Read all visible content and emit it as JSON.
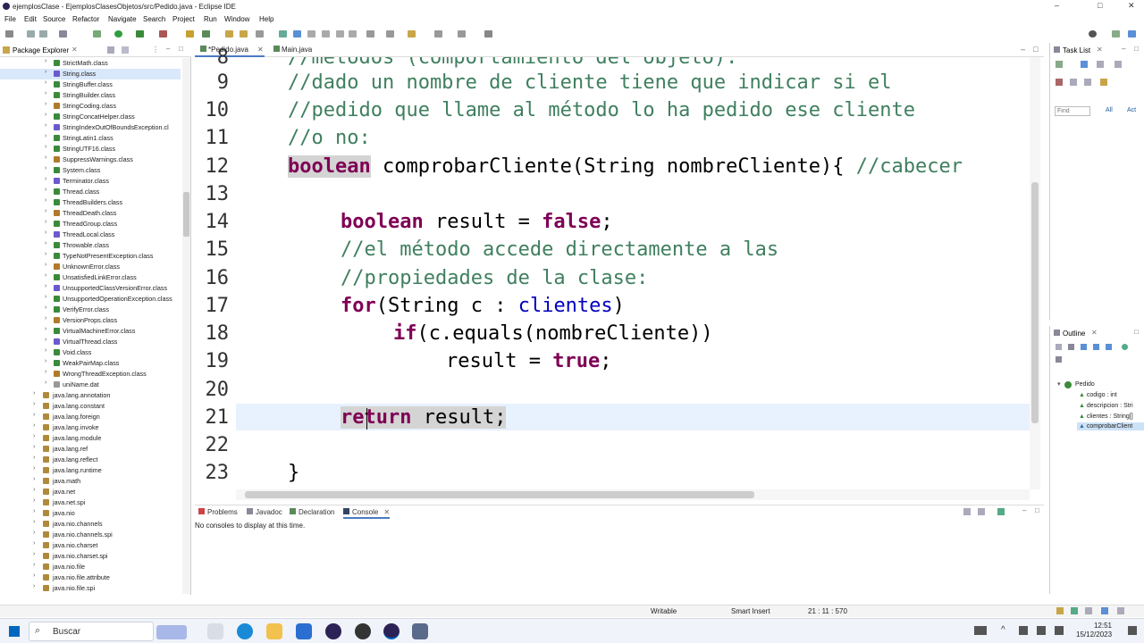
{
  "window": {
    "title": "ejemplosClase - EjemplosClasesObjetos/src/Pedido.java - Eclipse IDE",
    "min": "–",
    "max": "□",
    "close": "✕"
  },
  "menu": [
    "File",
    "Edit",
    "Source",
    "Refactor",
    "Navigate",
    "Search",
    "Project",
    "Run",
    "Window",
    "Help"
  ],
  "package_explorer": {
    "title": "Package Explorer",
    "classes": [
      "StrictMath.class",
      "String.class",
      "StringBuffer.class",
      "StringBuilder.class",
      "StringCoding.class",
      "StringConcatHelper.class",
      "StringIndexOutOfBoundsException.cl",
      "StringLatin1.class",
      "StringUTF16.class",
      "SuppressWarnings.class",
      "System.class",
      "Terminator.class",
      "Thread.class",
      "ThreadBuilders.class",
      "ThreadDeath.class",
      "ThreadGroup.class",
      "ThreadLocal.class",
      "Throwable.class",
      "TypeNotPresentException.class",
      "UnknownError.class",
      "UnsatisfiedLinkError.class",
      "UnsupportedClassVersionError.class",
      "UnsupportedOperationException.class",
      "VerifyError.class",
      "VersionProps.class",
      "VirtualMachineError.class",
      "VirtualThread.class",
      "Void.class",
      "WeakPairMap.class",
      "WrongThreadException.class",
      "uniName.dat"
    ],
    "packages": [
      "java.lang.annotation",
      "java.lang.constant",
      "java.lang.foreign",
      "java.lang.invoke",
      "java.lang.module",
      "java.lang.ref",
      "java.lang.reflect",
      "java.lang.runtime",
      "java.math",
      "java.net",
      "java.net.spi",
      "java.nio",
      "java.nio.channels",
      "java.nio.channels.spi",
      "java.nio.charset",
      "java.nio.charset.spi",
      "java.nio.file",
      "java.nio.file.attribute",
      "java.nio.file.spi"
    ]
  },
  "editor": {
    "tabs": [
      "*Pedido.java",
      "Main.java"
    ],
    "line_numbers": [
      "8",
      "9",
      "10",
      "11",
      "12",
      "13",
      "14",
      "15",
      "16",
      "17",
      "18",
      "19",
      "20",
      "21",
      "22",
      "23"
    ],
    "lines": {
      "l8": "//métodos (comportamiento del objeto):",
      "l9": "//dado un nombre de cliente tiene que indicar si el",
      "l10": "//pedido que llame al método lo ha pedido ese cliente",
      "l11": "//o no:",
      "l12_kw": "boolean",
      "l12_rest": " comprobarCliente(String nombreCliente){ ",
      "l12_cm": "//cabecer",
      "l14_kw": "boolean",
      "l14_mid": " result = ",
      "l14_kw2": "false",
      "l14_end": ";",
      "l15": "//el método accede directamente a las",
      "l16": "//propiedades de la clase:",
      "l17_kw": "for",
      "l17_mid": "(String c : ",
      "l17_fld": "clientes",
      "l17_end": ")",
      "l18_kw": "if",
      "l18_rest": "(c.equals(nombreCliente))",
      "l19_mid": "result = ",
      "l19_kw": "true",
      "l19_end": ";",
      "l21_kw": "return",
      "l21_rest": " result;",
      "l23": "}"
    }
  },
  "console": {
    "tabs": [
      "Problems",
      "Javadoc",
      "Declaration",
      "Console"
    ],
    "message": "No consoles to display at this time."
  },
  "tasklist": {
    "title": "Task List",
    "find_placeholder": "Find",
    "all": "All",
    "activate": "Act"
  },
  "outline": {
    "title": "Outline",
    "root": "Pedido",
    "items": [
      "codigo : int",
      "descripcion : Stri",
      "clientes : String[]",
      "comprobarClient"
    ]
  },
  "status": {
    "writable": "Writable",
    "insert": "Smart Insert",
    "position": "21 : 11 : 570"
  },
  "taskbar": {
    "search": "Buscar",
    "time": "12:51",
    "date": "15/12/2023"
  },
  "colors": {
    "keyword": "#7f0055",
    "comment": "#3f7f5f",
    "field": "#0000c0",
    "current_line": "#e8f2fe"
  }
}
